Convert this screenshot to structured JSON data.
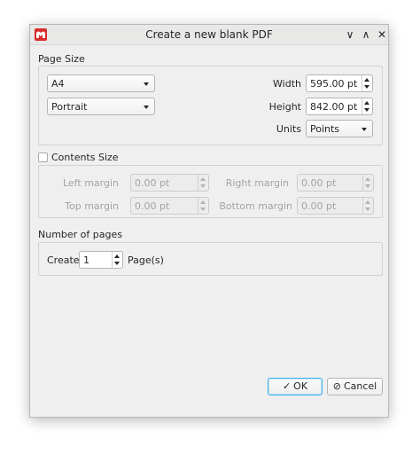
{
  "window": {
    "title": "Create a new blank PDF",
    "controls": {
      "minimize": "∨",
      "maximize": "∧",
      "close": "✕"
    }
  },
  "page_size": {
    "heading": "Page Size",
    "paper": "A4",
    "orientation": "Portrait",
    "width_label": "Width",
    "width_value": "595.00 pt",
    "height_label": "Height",
    "height_value": "842.00 pt",
    "units_label": "Units",
    "units_value": "Points"
  },
  "contents_size": {
    "heading": "Contents Size",
    "checked": false,
    "left_margin_label": "Left margin",
    "left_margin_value": "0.00 pt",
    "right_margin_label": "Right margin",
    "right_margin_value": "0.00 pt",
    "top_margin_label": "Top margin",
    "top_margin_value": "0.00 pt",
    "bottom_margin_label": "Bottom margin",
    "bottom_margin_value": "0.00 pt"
  },
  "pages": {
    "heading": "Number of pages",
    "create_label": "Create",
    "count": "1",
    "suffix": "Page(s)"
  },
  "buttons": {
    "ok_icon": "✓",
    "ok": "OK",
    "cancel_icon": "⊘",
    "cancel": "Cancel"
  },
  "colors": {
    "accent": "#3daee9",
    "app_icon": "#da2b2b"
  }
}
